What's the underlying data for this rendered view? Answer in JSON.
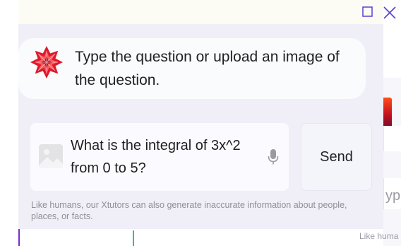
{
  "window": {
    "maximize_icon": "maximize-square-icon",
    "close_icon": "close-x-icon",
    "accent_color": "#5b3fd6"
  },
  "assistant": {
    "icon": "star-burst-logo-icon",
    "icon_color": "#e0192b",
    "message": "Type the question or upload an image of the question."
  },
  "input": {
    "image_icon": "image-placeholder-icon",
    "value": "What is the integral of 3x^2 from 0 to 5?",
    "mic_icon": "microphone-icon"
  },
  "send": {
    "label": "Send"
  },
  "disclaimer": "Like humans, our Xtutors can also generate inaccurate information about people, places, or facts.",
  "background_window": {
    "typed_fragment": "ype",
    "disclaimer_fragment": "Like huma"
  }
}
